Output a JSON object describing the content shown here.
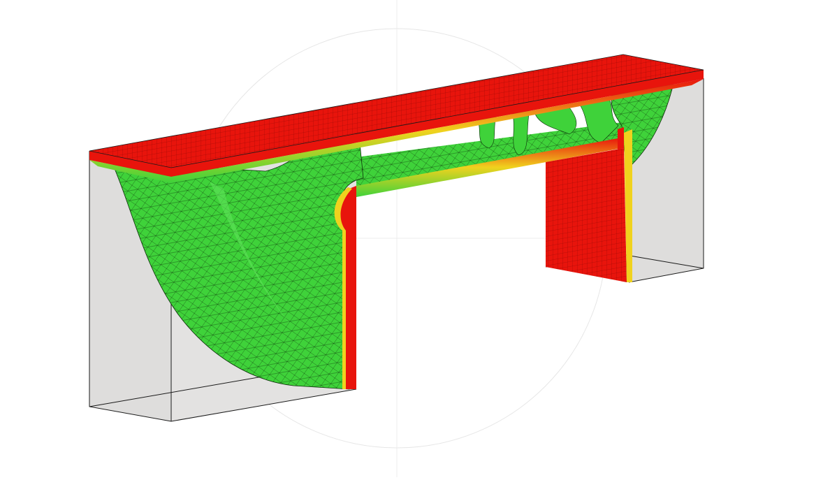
{
  "viewport": {
    "background": "#ffffff",
    "guide_color": "#e6e6e6",
    "colors": {
      "solid": "#e8140c",
      "transition": "#f0d21e",
      "material": "#3fd23a",
      "material_light": "#5fe35a",
      "design_space": "#dedddc",
      "edge": "#1a1a1a",
      "mesh": "#0b2a08"
    }
  }
}
